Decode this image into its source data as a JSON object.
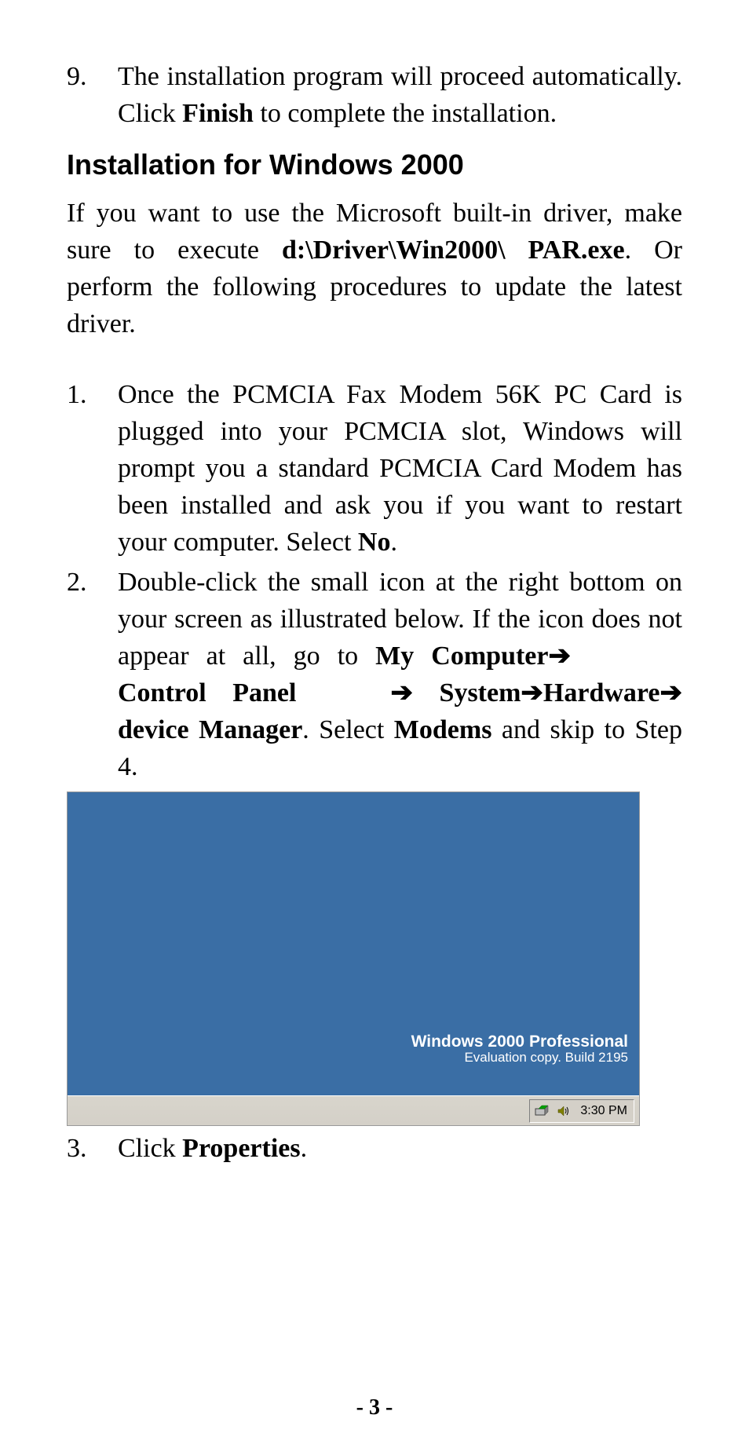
{
  "step9": {
    "num": "9.",
    "pre": "The installation program will proceed automatically. Click ",
    "bold": "Finish",
    "post": " to complete the installation."
  },
  "heading": "Installation for Windows 2000",
  "intro": {
    "pre": "If you want to use the Microsoft built-in driver, make sure to execute ",
    "bold": "d:\\Driver\\Win2000\\ PAR.exe",
    "post": ".  Or perform the following procedures to update the latest driver."
  },
  "step1": {
    "num": "1.",
    "pre": "Once the PCMCIA Fax Modem 56K PC Card is plugged into your PCMCIA slot, Windows will prompt you a standard PCMCIA Card Modem has been installed and ask you if you want to restart your computer. Select ",
    "bold": "No",
    "post": "."
  },
  "step2": {
    "num": "2.",
    "pre": "Double-click the small icon at the right bottom on your screen as illustrated below. If the icon does not appear at all, go to ",
    "nav_my_computer": "My Computer",
    "arrow": "➔",
    "nav_control_panel": "Control Panel",
    "nav_system": "System",
    "nav_hardware": "Hardware",
    "nav_device_manager": "device Manager",
    "post1": ". Select ",
    "bold_modems": "Modems",
    "post2": " and skip to Step 4."
  },
  "screenshot": {
    "watermark_title": "Windows 2000 Professional",
    "watermark_sub": "Evaluation copy. Build 2195",
    "clock": "3:30 PM"
  },
  "step3": {
    "num": "3.",
    "pre": "Click ",
    "bold": "Properties",
    "post": "."
  },
  "page_number": "- 3 -"
}
